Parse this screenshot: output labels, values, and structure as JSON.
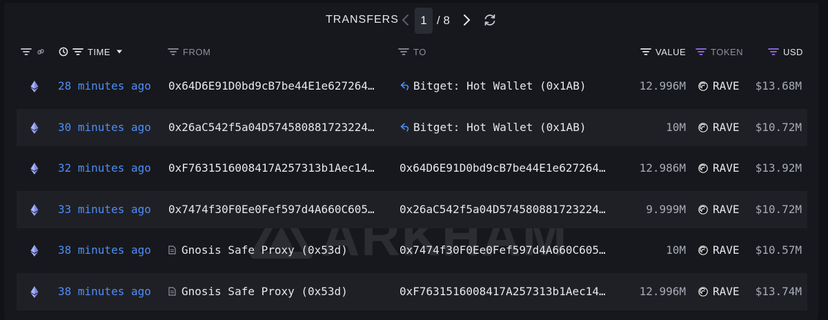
{
  "header": {
    "title": "TRANSFERS",
    "current_page": "1",
    "total_pages": "/ 8"
  },
  "columns": {
    "time": "TIME",
    "from": "FROM",
    "to": "TO",
    "value": "VALUE",
    "token": "TOKEN",
    "usd": "USD"
  },
  "rows": [
    {
      "time": "28 minutes ago",
      "from": "0x64D6E91D0bd9cB7be44E1e627264…",
      "from_type": "address",
      "to": "Bitget: Hot Wallet (0x1AB)",
      "to_type": "entity",
      "value": "12.996M",
      "token": "RAVE",
      "usd": "$13.68M"
    },
    {
      "time": "30 minutes ago",
      "from": "0x26aC542f5a04D574580881723224…",
      "from_type": "address",
      "to": "Bitget: Hot Wallet (0x1AB)",
      "to_type": "entity",
      "value": "10M",
      "token": "RAVE",
      "usd": "$10.72M"
    },
    {
      "time": "32 minutes ago",
      "from": "0xF7631516008417A257313b1Aec14…",
      "from_type": "address",
      "to": "0x64D6E91D0bd9cB7be44E1e627264…",
      "to_type": "address",
      "value": "12.986M",
      "token": "RAVE",
      "usd": "$13.92M"
    },
    {
      "time": "33 minutes ago",
      "from": "0x7474f30F0Ee0Fef597d4A660C605…",
      "from_type": "address",
      "to": "0x26aC542f5a04D574580881723224…",
      "to_type": "address",
      "value": "9.999M",
      "token": "RAVE",
      "usd": "$10.72M"
    },
    {
      "time": "38 minutes ago",
      "from": "Gnosis Safe Proxy (0x53d)",
      "from_type": "contract",
      "to": "0x7474f30F0Ee0Fef597d4A660C605…",
      "to_type": "address",
      "value": "10M",
      "token": "RAVE",
      "usd": "$10.57M"
    },
    {
      "time": "38 minutes ago",
      "from": "Gnosis Safe Proxy (0x53d)",
      "from_type": "contract",
      "to": "0xF7631516008417A257313b1Aec14…",
      "to_type": "address",
      "value": "12.996M",
      "token": "RAVE",
      "usd": "$13.74M"
    }
  ],
  "watermark": "ARKHAM",
  "colors": {
    "link": "#4d8ef7",
    "accent_purple": "#9b6cf0",
    "eth": "#7b8ce8"
  }
}
